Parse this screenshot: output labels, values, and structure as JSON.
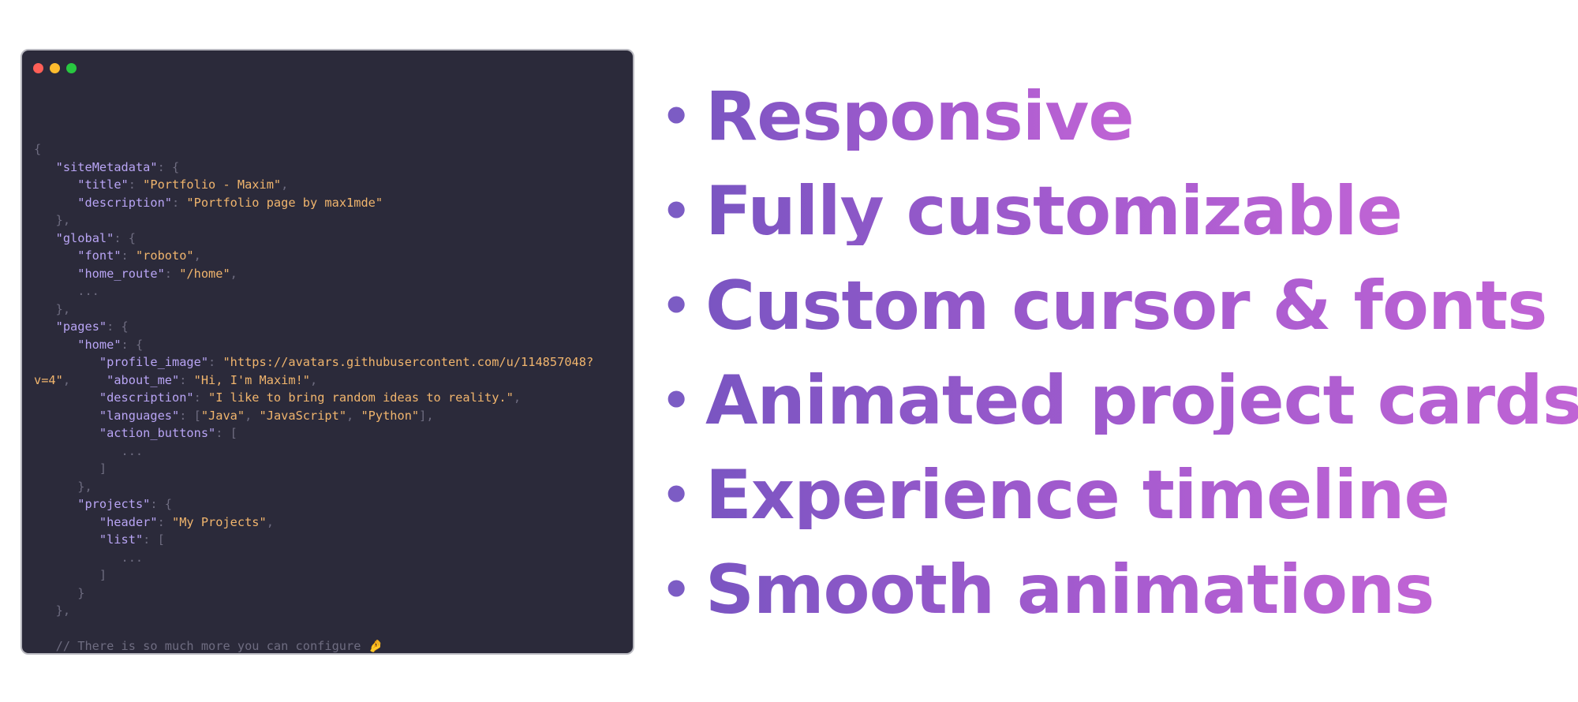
{
  "window_dots": [
    {
      "name": "close-dot",
      "color": "#ff5f57"
    },
    {
      "name": "minimize-dot",
      "color": "#febc2e"
    },
    {
      "name": "zoom-dot",
      "color": "#28c840"
    }
  ],
  "colors": {
    "editor_background": "#2b2a3a",
    "key": "#b9a5f5",
    "string": "#f1b56d",
    "punctuation": "#6e6c80",
    "feature_gradient_start": "#7a55c2",
    "feature_gradient_end": "#c064d5"
  },
  "code_lines": [
    [
      {
        "t": "p",
        "v": "{"
      }
    ],
    [
      {
        "t": "p",
        "v": "   "
      },
      {
        "t": "k",
        "v": "\"siteMetadata\""
      },
      {
        "t": "p",
        "v": ": {"
      }
    ],
    [
      {
        "t": "p",
        "v": "      "
      },
      {
        "t": "k",
        "v": "\"title\""
      },
      {
        "t": "p",
        "v": ": "
      },
      {
        "t": "s",
        "v": "\"Portfolio - Maxim\""
      },
      {
        "t": "p",
        "v": ","
      }
    ],
    [
      {
        "t": "p",
        "v": "      "
      },
      {
        "t": "k",
        "v": "\"description\""
      },
      {
        "t": "p",
        "v": ": "
      },
      {
        "t": "s",
        "v": "\"Portfolio page by max1mde\""
      }
    ],
    [
      {
        "t": "p",
        "v": "   },"
      }
    ],
    [
      {
        "t": "p",
        "v": "   "
      },
      {
        "t": "k",
        "v": "\"global\""
      },
      {
        "t": "p",
        "v": ": {"
      }
    ],
    [
      {
        "t": "p",
        "v": "      "
      },
      {
        "t": "k",
        "v": "\"font\""
      },
      {
        "t": "p",
        "v": ": "
      },
      {
        "t": "s",
        "v": "\"roboto\""
      },
      {
        "t": "p",
        "v": ","
      }
    ],
    [
      {
        "t": "p",
        "v": "      "
      },
      {
        "t": "k",
        "v": "\"home_route\""
      },
      {
        "t": "p",
        "v": ": "
      },
      {
        "t": "s",
        "v": "\"/home\""
      },
      {
        "t": "p",
        "v": ","
      }
    ],
    [
      {
        "t": "p",
        "v": "      ..."
      }
    ],
    [
      {
        "t": "p",
        "v": "   },"
      }
    ],
    [
      {
        "t": "p",
        "v": "   "
      },
      {
        "t": "k",
        "v": "\"pages\""
      },
      {
        "t": "p",
        "v": ": {"
      }
    ],
    [
      {
        "t": "p",
        "v": "      "
      },
      {
        "t": "k",
        "v": "\"home\""
      },
      {
        "t": "p",
        "v": ": {"
      }
    ],
    [
      {
        "t": "p",
        "v": "         "
      },
      {
        "t": "k",
        "v": "\"profile_image\""
      },
      {
        "t": "p",
        "v": ": "
      },
      {
        "t": "s",
        "v": "\"https://avatars.githubusercontent.com/u/114857048?"
      }
    ],
    [
      {
        "t": "s",
        "v": "v=4\""
      },
      {
        "t": "p",
        "v": ",     "
      },
      {
        "t": "k",
        "v": "\"about_me\""
      },
      {
        "t": "p",
        "v": ": "
      },
      {
        "t": "s",
        "v": "\"Hi, I'm Maxim!\""
      },
      {
        "t": "p",
        "v": ","
      }
    ],
    [
      {
        "t": "p",
        "v": "         "
      },
      {
        "t": "k",
        "v": "\"description\""
      },
      {
        "t": "p",
        "v": ": "
      },
      {
        "t": "s",
        "v": "\"I like to bring random ideas to reality.\""
      },
      {
        "t": "p",
        "v": ","
      }
    ],
    [
      {
        "t": "p",
        "v": "         "
      },
      {
        "t": "k",
        "v": "\"languages\""
      },
      {
        "t": "p",
        "v": ": ["
      },
      {
        "t": "s",
        "v": "\"Java\""
      },
      {
        "t": "p",
        "v": ", "
      },
      {
        "t": "s",
        "v": "\"JavaScript\""
      },
      {
        "t": "p",
        "v": ", "
      },
      {
        "t": "s",
        "v": "\"Python\""
      },
      {
        "t": "p",
        "v": "],"
      }
    ],
    [
      {
        "t": "p",
        "v": "         "
      },
      {
        "t": "k",
        "v": "\"action_buttons\""
      },
      {
        "t": "p",
        "v": ": ["
      }
    ],
    [
      {
        "t": "p",
        "v": "            ..."
      }
    ],
    [
      {
        "t": "p",
        "v": "         ]"
      }
    ],
    [
      {
        "t": "p",
        "v": "      },"
      }
    ],
    [
      {
        "t": "p",
        "v": "      "
      },
      {
        "t": "k",
        "v": "\"projects\""
      },
      {
        "t": "p",
        "v": ": {"
      }
    ],
    [
      {
        "t": "p",
        "v": "         "
      },
      {
        "t": "k",
        "v": "\"header\""
      },
      {
        "t": "p",
        "v": ": "
      },
      {
        "t": "s",
        "v": "\"My Projects\""
      },
      {
        "t": "p",
        "v": ","
      }
    ],
    [
      {
        "t": "p",
        "v": "         "
      },
      {
        "t": "k",
        "v": "\"list\""
      },
      {
        "t": "p",
        "v": ": ["
      }
    ],
    [
      {
        "t": "p",
        "v": "            ..."
      }
    ],
    [
      {
        "t": "p",
        "v": "         ]"
      }
    ],
    [
      {
        "t": "p",
        "v": "      }"
      }
    ],
    [
      {
        "t": "p",
        "v": "   },"
      }
    ],
    [
      {
        "t": "p",
        "v": ""
      }
    ],
    [
      {
        "t": "c",
        "v": "   // There is so much more you can configure "
      },
      {
        "t": "emoji",
        "v": "🤌"
      }
    ],
    [
      {
        "t": "p",
        "v": "}"
      }
    ]
  ],
  "features": [
    "Responsive",
    "Fully customizable",
    "Custom cursor & fonts",
    "Animated project cards",
    "Experience timeline",
    "Smooth animations"
  ],
  "bullet_char": "•"
}
